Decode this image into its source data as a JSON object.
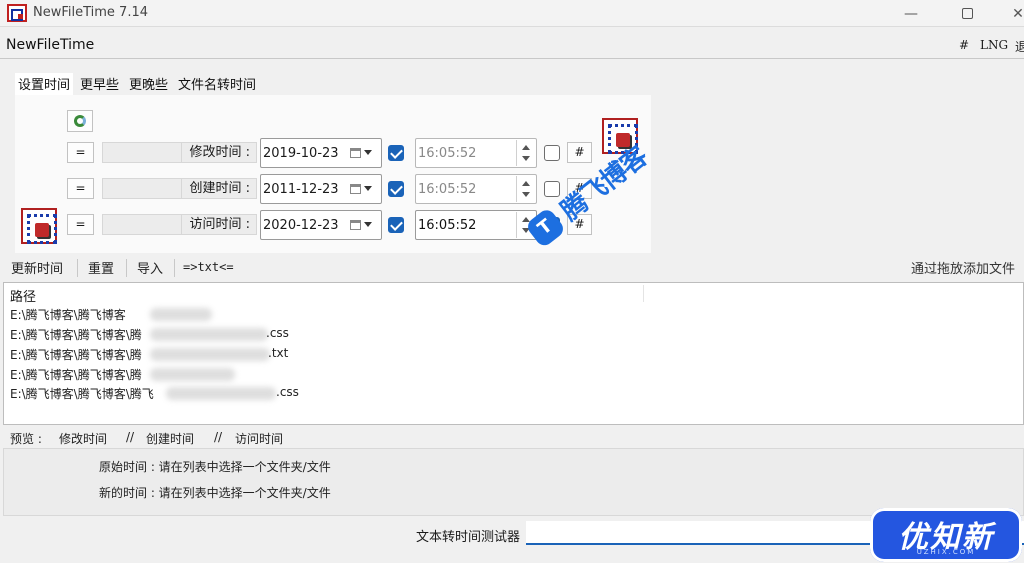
{
  "window": {
    "title": "NewFileTime 7.14",
    "minimize": "—",
    "close": "✕"
  },
  "menubar": {
    "app_name": "NewFileTime",
    "hash": "#",
    "lng": "LNG",
    "exit": "退"
  },
  "tabs": [
    "设置时间",
    "更早些",
    "更晚些",
    "文件名转时间"
  ],
  "time_rows": [
    {
      "eq": "=",
      "label": "修改时间 :",
      "date": "2019-10-23",
      "date_checked": true,
      "time": "16:05:52",
      "time_checked": false,
      "hash": "#"
    },
    {
      "eq": "=",
      "label": "创建时间 :",
      "date": "2011-12-23",
      "date_checked": true,
      "time": "16:05:52",
      "time_checked": false,
      "hash": "#"
    },
    {
      "eq": "=",
      "label": "访问时间 :",
      "date": "2020-12-23",
      "date_checked": true,
      "time": "16:05:52",
      "time_checked": true,
      "hash": "#"
    }
  ],
  "toolbar": {
    "update": "更新时间",
    "reset": "重置",
    "import": "导入",
    "txt": "=>txt<=",
    "drag_hint": "通过拖放添加文件"
  },
  "filelist": {
    "header": "路径",
    "rows": [
      {
        "prefix": "E:\\腾飞博客\\腾飞博客",
        "ext": ""
      },
      {
        "prefix": "E:\\腾飞博客\\腾飞博客\\腾",
        "ext": ".css"
      },
      {
        "prefix": "E:\\腾飞博客\\腾飞博客\\腾",
        "ext": ".txt"
      },
      {
        "prefix": "E:\\腾飞博客\\腾飞博客\\腾",
        "ext": ""
      },
      {
        "prefix": "E:\\腾飞博客\\腾飞博客\\腾飞",
        "ext": ".css"
      }
    ]
  },
  "preview": {
    "label": "预览 :",
    "modify": "修改时间",
    "sep1": "//",
    "create": "创建时间",
    "sep2": "//",
    "access": "访问时间",
    "original": "原始时间 : 请在列表中选择一个文件夹/文件",
    "new": "新的时间 : 请在列表中选择一个文件夹/文件"
  },
  "tester": {
    "label": "文本转时间测试器",
    "value": ""
  },
  "watermarks": {
    "blog": "腾飞博客",
    "blog_logo": "T",
    "corner": "优知新",
    "corner_sub": "UZHIX.COM"
  },
  "colors": {
    "accent": "#1a63b8",
    "watermark_blue": "#1d6fe0",
    "corner_badge": "#2456e0",
    "icon_red": "#b02020"
  }
}
